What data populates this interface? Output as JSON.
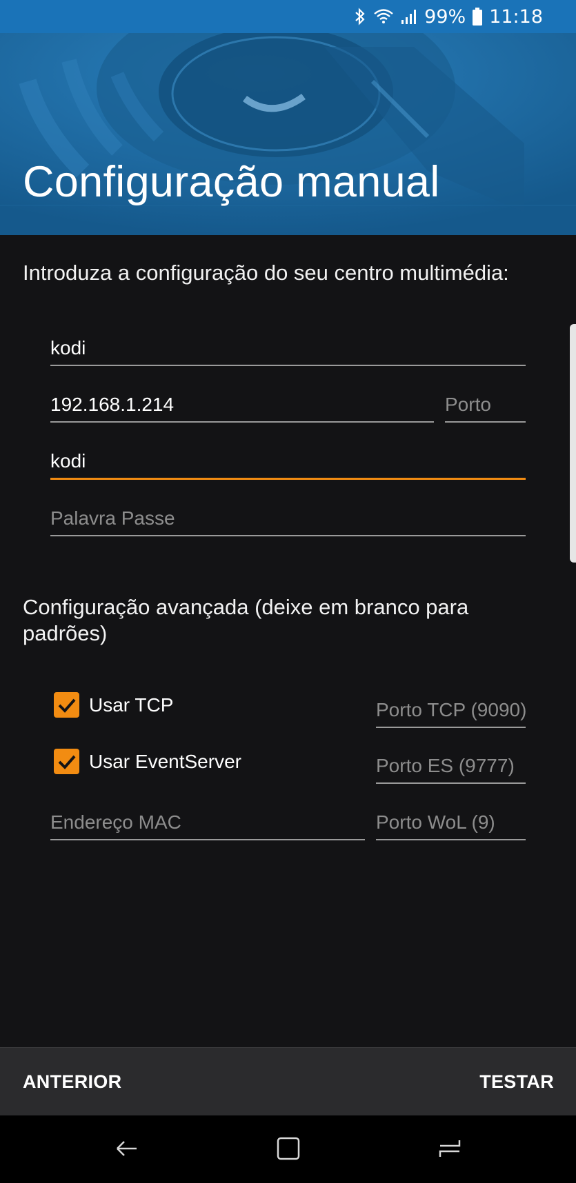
{
  "status_bar": {
    "battery": "99%",
    "time": "11:18",
    "icons": [
      "bluetooth-icon",
      "wifi-icon",
      "signal-icon",
      "battery-icon"
    ]
  },
  "header": {
    "title": "Configuração manual"
  },
  "intro": "Introduza a configuração do seu centro multimédia:",
  "form": {
    "name": {
      "value": "kodi",
      "placeholder": ""
    },
    "address": {
      "value": "192.168.1.214",
      "placeholder": ""
    },
    "port": {
      "value": "",
      "placeholder": "Porto"
    },
    "username": {
      "value": "kodi",
      "placeholder": ""
    },
    "password": {
      "value": "",
      "placeholder": "Palavra Passe"
    }
  },
  "advanced": {
    "title": "Configuração avançada (deixe em branco para padrões)",
    "use_tcp": {
      "label": "Usar TCP",
      "checked": true
    },
    "tcp_port": {
      "value": "",
      "placeholder": "Porto TCP (9090)"
    },
    "use_eventserver": {
      "label": "Usar EventServer",
      "checked": true
    },
    "es_port": {
      "value": "",
      "placeholder": "Porto ES (9777)"
    },
    "mac": {
      "value": "",
      "placeholder": "Endereço MAC"
    },
    "wol_port": {
      "value": "",
      "placeholder": "Porto WoL (9)"
    }
  },
  "buttons": {
    "previous": "ANTERIOR",
    "test": "TESTAR"
  },
  "colors": {
    "status_bar": "#1a73b8",
    "background": "#131315",
    "accent": "#f28c12",
    "bottom_bar": "#2b2b2d"
  }
}
